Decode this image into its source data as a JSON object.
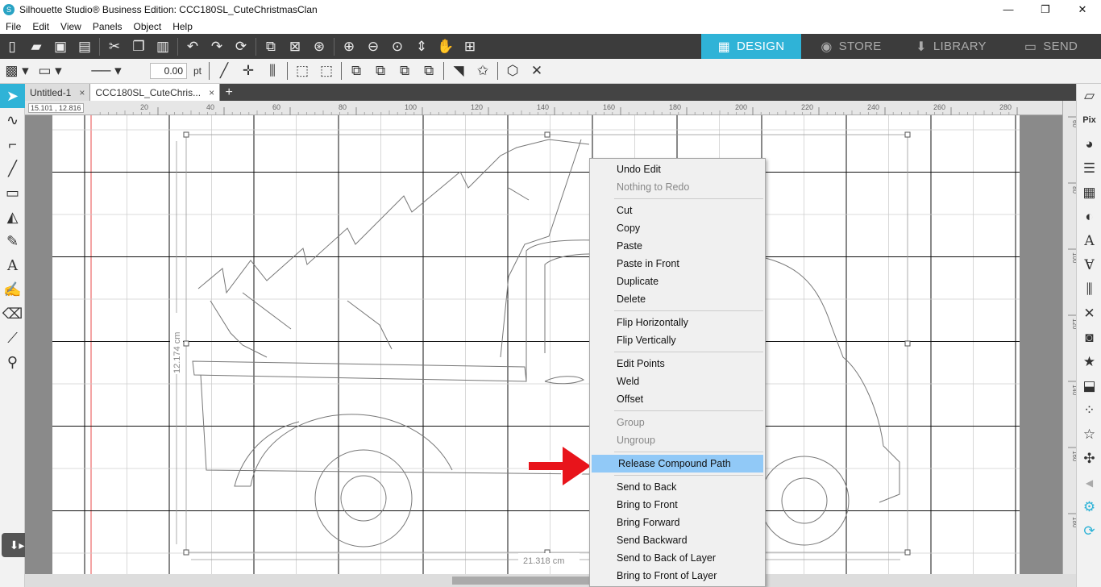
{
  "window": {
    "title": "Silhouette Studio® Business Edition: CCC180SL_CuteChristmasClan",
    "min": "—",
    "max": "❐",
    "close": "✕"
  },
  "menu": [
    "File",
    "Edit",
    "View",
    "Panels",
    "Object",
    "Help"
  ],
  "modes": [
    {
      "label": "DESIGN",
      "icon": "grid-icon",
      "active": true
    },
    {
      "label": "STORE",
      "icon": "store-icon",
      "active": false
    },
    {
      "label": "LIBRARY",
      "icon": "library-icon",
      "active": false
    },
    {
      "label": "SEND",
      "icon": "send-icon",
      "active": false
    }
  ],
  "line_tools": {
    "line_width_value": "0.00",
    "unit": "pt"
  },
  "tabs": [
    {
      "label": "Untitled-1",
      "active": false
    },
    {
      "label": "CCC180SL_CuteChris...",
      "active": true
    }
  ],
  "ruler": {
    "coord_readout": "15.101 , 12.816",
    "top_ticks": [
      "20",
      "40",
      "60",
      "80",
      "100",
      "120",
      "140",
      "160",
      "180",
      "200",
      "220",
      "240",
      "260",
      "280"
    ],
    "right_ticks": [
      "60",
      "80",
      "100",
      "120",
      "140",
      "160",
      "180"
    ]
  },
  "dimensions": {
    "height_label": "12.174 cm",
    "width_label": "21.318 cm"
  },
  "context_menu": {
    "groups": [
      [
        {
          "label": "Undo Edit",
          "enabled": true
        },
        {
          "label": "Nothing to Redo",
          "enabled": false
        }
      ],
      [
        {
          "label": "Cut",
          "enabled": true
        },
        {
          "label": "Copy",
          "enabled": true
        },
        {
          "label": "Paste",
          "enabled": true
        },
        {
          "label": "Paste in Front",
          "enabled": true
        },
        {
          "label": "Duplicate",
          "enabled": true
        },
        {
          "label": "Delete",
          "enabled": true
        }
      ],
      [
        {
          "label": "Flip Horizontally",
          "enabled": true
        },
        {
          "label": "Flip Vertically",
          "enabled": true
        }
      ],
      [
        {
          "label": "Edit Points",
          "enabled": true
        },
        {
          "label": "Weld",
          "enabled": true
        },
        {
          "label": "Offset",
          "enabled": true
        }
      ],
      [
        {
          "label": "Group",
          "enabled": false
        },
        {
          "label": "Ungroup",
          "enabled": false
        }
      ],
      [
        {
          "label": "Release Compound Path",
          "enabled": true,
          "highlighted": true
        }
      ],
      [
        {
          "label": "Send to Back",
          "enabled": true
        },
        {
          "label": "Bring to Front",
          "enabled": true
        },
        {
          "label": "Bring Forward",
          "enabled": true
        },
        {
          "label": "Send Backward",
          "enabled": true
        },
        {
          "label": "Send to Back of Layer",
          "enabled": true
        },
        {
          "label": "Bring to Front of Layer",
          "enabled": true
        }
      ]
    ]
  },
  "colors": {
    "accent": "#2fb3d7",
    "highlight": "#91c9f7",
    "arrow": "#e8141b",
    "toolbar_dark": "#3c3c3c"
  }
}
